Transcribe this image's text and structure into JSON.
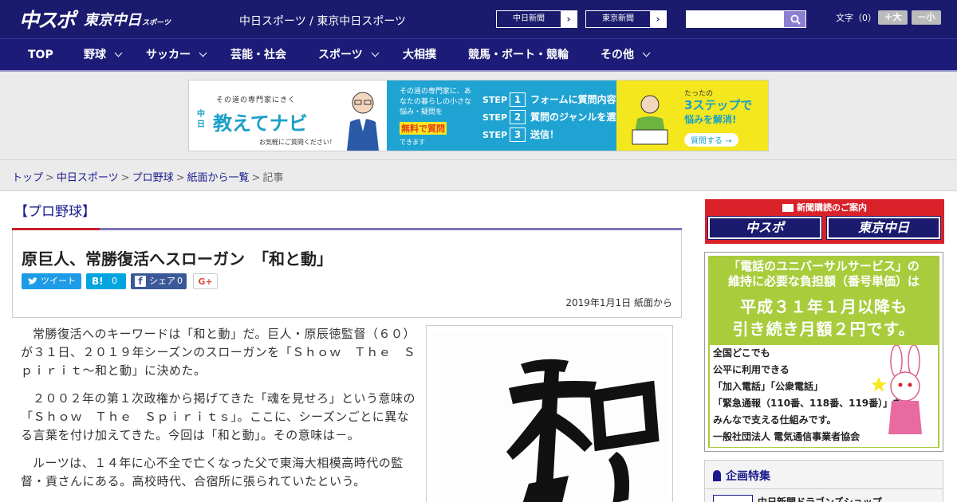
{
  "header": {
    "logo_primary": "中スポ",
    "logo_secondary": "東京中日",
    "logo_secondary_suffix": "スポーツ",
    "site_title": "中日スポーツ / 東京中日スポーツ",
    "links": [
      {
        "label": "中日新聞"
      },
      {
        "label": "東京新聞"
      }
    ],
    "search": {
      "value": "",
      "placeholder": ""
    },
    "font_size": {
      "label": "文字（0）",
      "increase": "＋大",
      "decrease": "－小"
    }
  },
  "nav": {
    "items": [
      {
        "label": "TOP",
        "has_menu": false
      },
      {
        "label": "野球",
        "has_menu": true
      },
      {
        "label": "サッカー",
        "has_menu": true
      },
      {
        "label": "芸能・社会",
        "has_menu": false
      },
      {
        "label": "スポーツ",
        "has_menu": true
      },
      {
        "label": "大相撲",
        "has_menu": false
      },
      {
        "label": "競馬・ボート・競輪",
        "has_menu": false
      },
      {
        "label": "その他",
        "has_menu": true
      }
    ]
  },
  "banner": {
    "tagline": "その道の専門家にきく",
    "brand_small": "中日",
    "title": "教えてナビ",
    "caption": "お気軽にご質問ください！",
    "mid_text": "その道の専門家に、あなたの暮らしの小さな悩み・疑問を",
    "mid_highlight": "無料で質問",
    "mid_end": "できます",
    "steps": [
      {
        "step": "STEP",
        "num": "1",
        "text": "フォームに質問内容を入力"
      },
      {
        "step": "STEP",
        "num": "2",
        "text": "質問のジャンルを選択"
      },
      {
        "step": "STEP",
        "num": "3",
        "text": "送信！"
      }
    ],
    "right_top": "たったの",
    "right_big": "3ステップで",
    "right_sub": "悩みを解消!",
    "right_cta": "質問する →"
  },
  "breadcrumb": {
    "items": [
      "トップ",
      "中日スポーツ",
      "プロ野球",
      "紙面から一覧"
    ],
    "current": "記事"
  },
  "article": {
    "category": "【プロ野球】",
    "title": "原巨人、常勝復活へスローガン　「和と動」",
    "share": {
      "tweet": "ツイート",
      "hatena_count": "0",
      "facebook": "シェア",
      "facebook_count": "0",
      "gplus": "G+"
    },
    "date": "2019年1月1日 紙面から",
    "paragraphs": [
      "常勝復活へのキーワードは「和と動」だ。巨人・原辰徳監督（６０）が３１日、２０１９年シーズンのスローガンを「Ｓｈｏｗ　Ｔｈｅ　Ｓｐｉｒｉｔ～和と動」に決めた。",
      "２００２年の第１次政権から掲げてきた「魂を見せろ」という意味の「Ｓｈｏｗ　Ｔｈｅ　Ｓｐｉｒｉｔｓ」。ここに、シーズンごとに異なる言葉を付け加えてきた。今回は「和と動」。その意味は－。",
      "ルーツは、１４年に心不全で亡くなった父で東海大相模高時代の監督・貢さんにある。高校時代、合宿所に張られていたという。"
    ],
    "photo_calligraphy": "和と"
  },
  "sidebar": {
    "subscription": {
      "head": "新聞購読のご案内",
      "buttons": [
        "中スポ",
        "東京中日"
      ]
    },
    "ad": {
      "line1": "「電話のユニバーサルサービス」の",
      "line2": "維持に必要な負担額（番号単価）は",
      "big1": "平成３１年１月以降も",
      "big2": "引き続き月額２円です。",
      "body": [
        "全国どこでも",
        "公平に利用できる",
        "「加入電話」「公衆電話」",
        "「緊急通報（110番、118番、119番）」を",
        "みんなで支える仕組みです。",
        "一般社団法人 電気通信事業者協会"
      ]
    },
    "feature": {
      "heading": "企画特集",
      "item": "中日新聞ドラゴンズショップ"
    }
  },
  "colors": {
    "header_bg": "#1a1a6e",
    "accent_red": "#cc1f2a",
    "link": "#1a1a8e"
  }
}
